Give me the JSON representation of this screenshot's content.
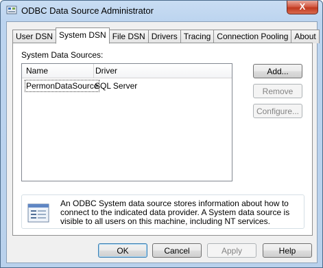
{
  "window": {
    "title": "ODBC Data Source Administrator",
    "close_glyph": "X"
  },
  "tabs": [
    {
      "label": "User DSN",
      "active": false
    },
    {
      "label": "System DSN",
      "active": true
    },
    {
      "label": "File DSN",
      "active": false
    },
    {
      "label": "Drivers",
      "active": false
    },
    {
      "label": "Tracing",
      "active": false
    },
    {
      "label": "Connection Pooling",
      "active": false
    },
    {
      "label": "About",
      "active": false
    }
  ],
  "system_dsn": {
    "section_label": "System Data Sources:",
    "columns": [
      "Name",
      "Driver"
    ],
    "rows": [
      {
        "name": "PermonDataSource",
        "driver": "SQL Server"
      }
    ],
    "buttons": {
      "add": "Add...",
      "remove": "Remove",
      "configure": "Configure..."
    },
    "info_text": "An ODBC System data source stores information about how to connect to the indicated data provider.   A System data source is visible to all users on this machine, including NT services."
  },
  "footer": {
    "ok": "OK",
    "cancel": "Cancel",
    "apply": "Apply",
    "help": "Help"
  },
  "icons": {
    "app": "odbc-admin-icon",
    "info": "database-document-icon"
  }
}
